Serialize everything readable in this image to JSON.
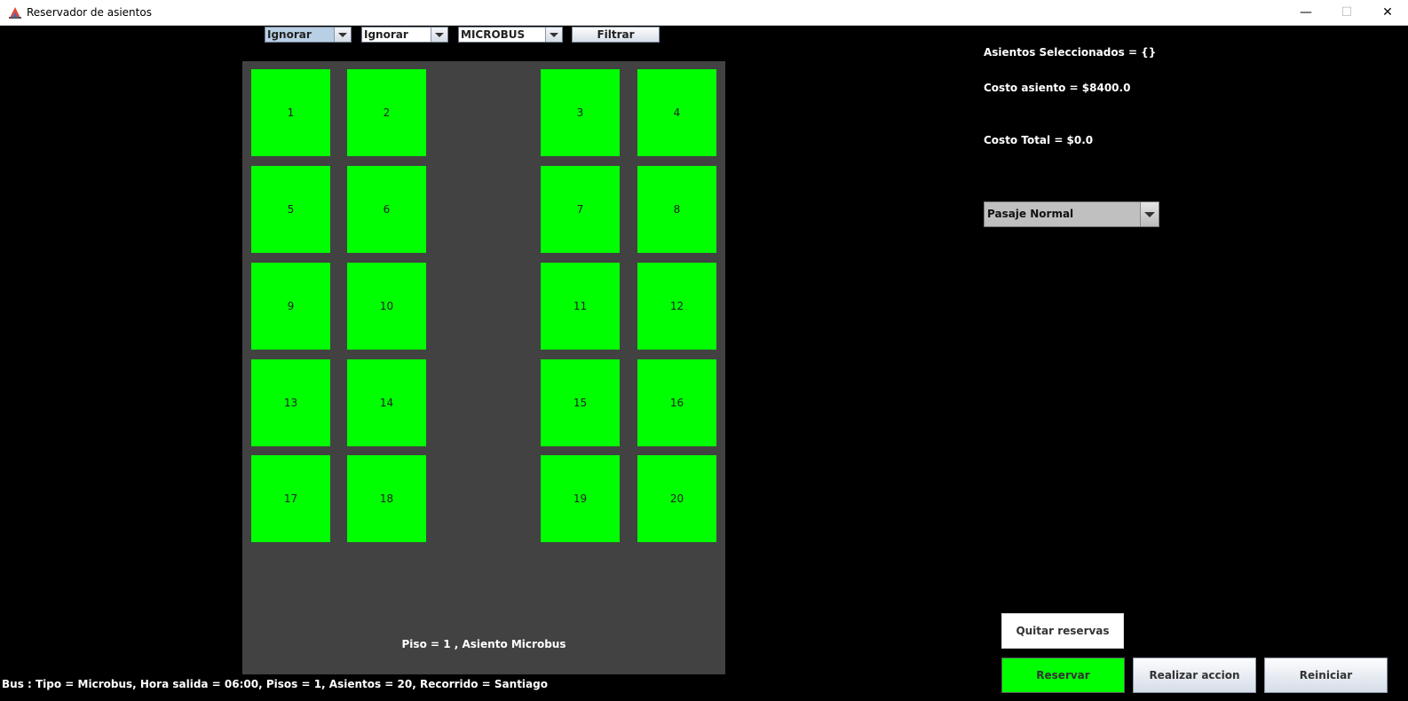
{
  "window": {
    "title": "Reservador de asientos",
    "minimize": "—",
    "maximize": "☐",
    "close": "✕"
  },
  "filters": {
    "combo1": "Ignorar",
    "combo2": "Ignorar",
    "combo3": "MICROBUS",
    "filter_button": "Filtrar"
  },
  "seats": [
    "1",
    "2",
    "3",
    "4",
    "5",
    "6",
    "7",
    "8",
    "9",
    "10",
    "11",
    "12",
    "13",
    "14",
    "15",
    "16",
    "17",
    "18",
    "19",
    "20"
  ],
  "seat_color": "#00ff00",
  "bus_panel": {
    "label": "Piso = 1 , Asiento Microbus"
  },
  "info": {
    "selected": "Asientos Seleccionados = {}",
    "seat_cost": "Costo asiento = $8400.0",
    "total_cost": "Costo Total = $0.0",
    "ticket_type": "Pasaje Normal"
  },
  "buttons": {
    "quitar": "Quitar reservas",
    "reservar": "Reservar",
    "accion": "Realizar accion",
    "reiniciar": "Reiniciar"
  },
  "status": "Bus : Tipo = Microbus, Hora salida = 06:00, Pisos = 1, Asientos = 20, Recorrido = Santiago"
}
